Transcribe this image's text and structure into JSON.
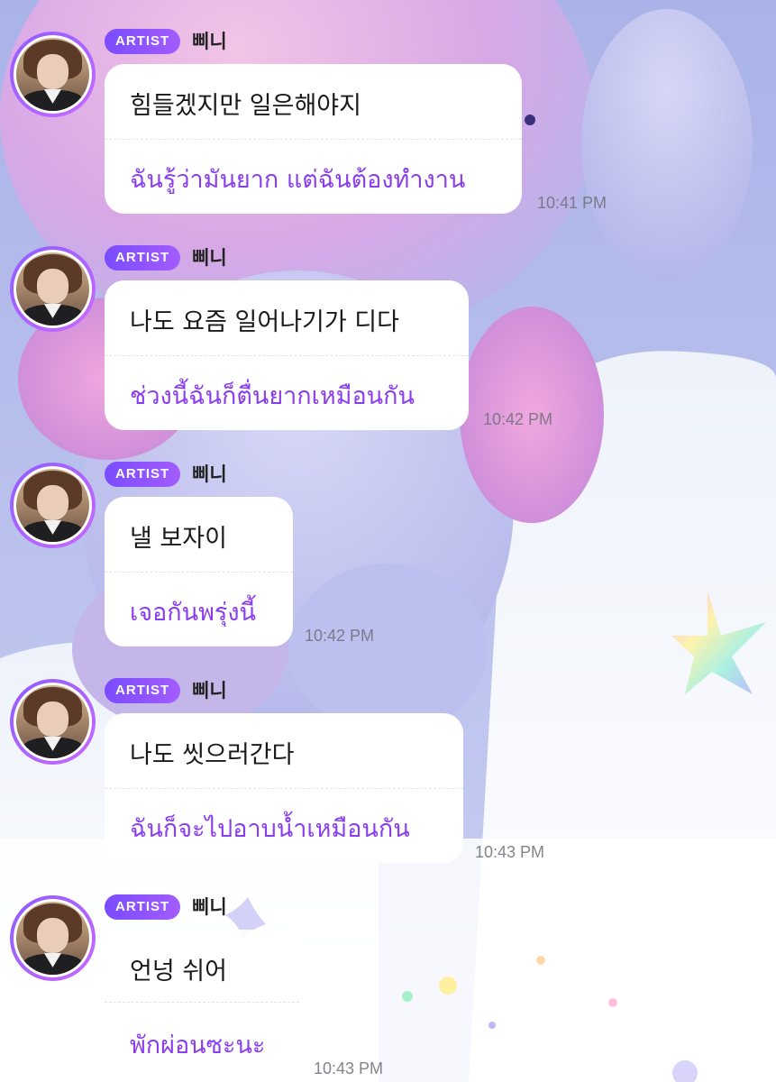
{
  "colors": {
    "badge": "#7a4cff",
    "translation_text": "#8a3cf0",
    "bubble": "#ffffff",
    "timestamp": "#6e6e78"
  },
  "messages": [
    {
      "badge": "ARTIST",
      "sender": "삐니",
      "text": "힘들겠지만 일은해야지",
      "translation": "ฉันรู้ว่ามันยาก แต่ฉันต้องทำงาน",
      "time": "10:41 PM"
    },
    {
      "badge": "ARTIST",
      "sender": "삐니",
      "text": "나도 요즘 일어나기가 디다",
      "translation": "ช่วงนี้ฉันก็ตื่นยากเหมือนกัน",
      "time": "10:42 PM"
    },
    {
      "badge": "ARTIST",
      "sender": "삐니",
      "text": "낼 보자이",
      "translation": "เจอกันพรุ่งนี้",
      "time": "10:42 PM"
    },
    {
      "badge": "ARTIST",
      "sender": "삐니",
      "text": "나도 씻으러간다",
      "translation": "ฉันก็จะไปอาบน้ำเหมือนกัน",
      "time": "10:43 PM"
    },
    {
      "badge": "ARTIST",
      "sender": "삐니",
      "text": "언넝 쉬어",
      "translation": "พักผ่อนซะนะ",
      "time": "10:43 PM"
    }
  ]
}
